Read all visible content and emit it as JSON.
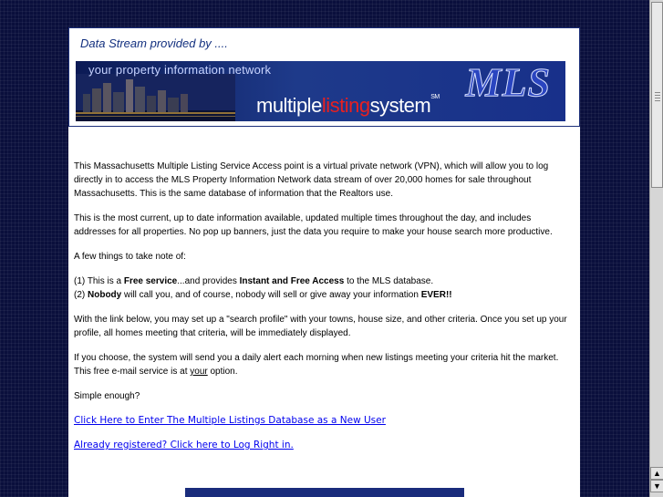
{
  "header": {
    "title": "Data Stream provided by ...."
  },
  "banner": {
    "tagline": "your property information network",
    "logo": "MLS",
    "wordmark_part1": "multiple",
    "wordmark_part2": "listing",
    "wordmark_part3": "system",
    "servicemark": "SM"
  },
  "body": {
    "para1": "This Massachusetts Multiple Listing Service Access point is a virtual private network (VPN),  which  will allow you to log directly in to access the  MLS Property Information Network data stream of over 20,000 homes for sale throughout Massachusetts.  This is the  same database of information that the Realtors use.",
    "para2": "This is the most current, up to date information available, updated multiple times throughout the day, and includes addresses for all properties. No pop up banners, just the data you require to make your house search more productive.",
    "para3": "A few things to take note of:",
    "item1_prefix": "(1) This is a ",
    "item1_bold1": "Free service",
    "item1_mid": "...and provides  ",
    "item1_bold2": "Instant and Free Access",
    "item1_suffix": " to the MLS database.",
    "item2_prefix": "(2) ",
    "item2_bold1": "Nobody",
    "item2_mid": " will call you, and of course, nobody will sell or give away your information ",
    "item2_bold2": "EVER!!",
    "para4": "With the link below, you may set up a \"search profile\" with your towns, house size, and other criteria.  Once you set up your profile, all homes meeting that criteria, will be immediately displayed.",
    "para5_prefix": "If you choose, the system will send you a daily alert each morning when new listings meeting your criteria hit the market. This free e-mail service is at ",
    "para5_underline": "your",
    "para5_suffix": " option.",
    "para6": "Simple enough?",
    "link_new_user": "Click Here to Enter The Multiple Listings Database  as a New User",
    "link_login": "Already registered? Click here to Log Right in."
  },
  "scrollbar": {
    "up_arrow": "▲",
    "down_arrow": "▼"
  }
}
